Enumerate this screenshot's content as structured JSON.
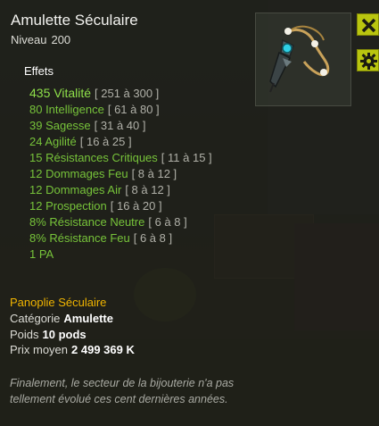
{
  "item": {
    "name": "Amulette Séculaire",
    "level_label": "Niveau",
    "level_value": "200",
    "icon": "amulet-item-icon"
  },
  "buttons": {
    "close_icon": "close-icon",
    "settings_icon": "gear-icon"
  },
  "effects": {
    "title": "Effets",
    "list": [
      {
        "text": "435 Vitalité",
        "range": "[ 251 à 300 ]"
      },
      {
        "text": "80 Intelligence",
        "range": "[ 61 à 80 ]"
      },
      {
        "text": "39 Sagesse",
        "range": "[ 31 à 40 ]"
      },
      {
        "text": "24 Agilité",
        "range": "[ 16 à 25 ]"
      },
      {
        "text": "15 Résistances Critiques",
        "range": "[ 11 à 15 ]"
      },
      {
        "text": "12 Dommages Feu",
        "range": "[ 8 à 12 ]"
      },
      {
        "text": "12 Dommages Air",
        "range": "[ 8 à 12 ]"
      },
      {
        "text": "12 Prospection",
        "range": "[ 16 à 20 ]"
      },
      {
        "text": "8% Résistance Neutre",
        "range": "[ 6 à 8 ]"
      },
      {
        "text": "8% Résistance Feu",
        "range": "[ 6 à 8 ]"
      },
      {
        "text": "1 PA",
        "range": ""
      }
    ]
  },
  "details": {
    "set_name": "Panoplie Séculaire",
    "category_label": "Catégorie",
    "category_value": "Amulette",
    "weight_label": "Poids",
    "weight_value": "10 pods",
    "price_label": "Prix moyen",
    "price_value": "2 499 369 K"
  },
  "description": "Finalement, le secteur de la bijouterie n'a pas tellement évolué ces cent dernières années.",
  "colors": {
    "effect_green": "#77c33a",
    "set_gold": "#f0b400",
    "button_yellow": "#b9c50f"
  }
}
